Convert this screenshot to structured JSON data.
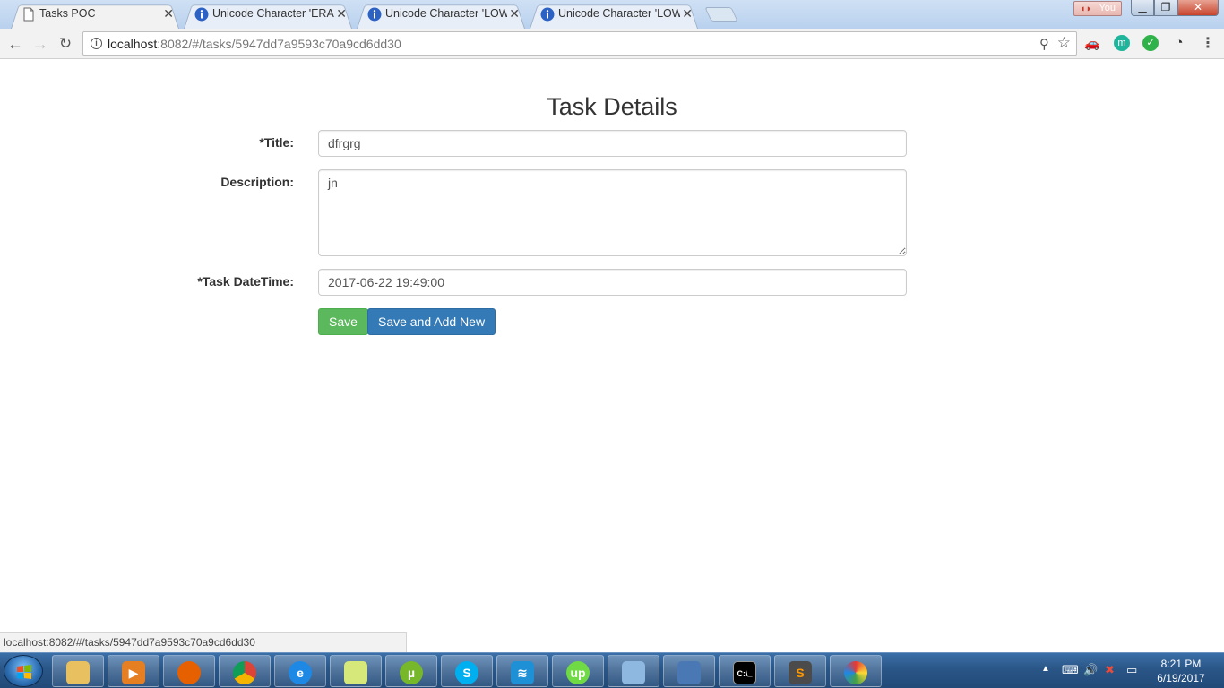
{
  "browser": {
    "tabs": [
      {
        "title": "Tasks POC",
        "icon": "page-icon",
        "active": true
      },
      {
        "title": "Unicode Character 'ERAS",
        "icon": "info-circle-icon",
        "active": false
      },
      {
        "title": "Unicode Character 'LOW",
        "icon": "info-circle-icon",
        "active": false
      },
      {
        "title": "Unicode Character 'LOW",
        "icon": "info-circle-icon",
        "active": false
      }
    ],
    "profile_label": "You",
    "url_host": "localhost",
    "url_rest": ":8082/#/tasks/5947dd7a9593c70a9cd6dd30",
    "extension_badge_m": "m",
    "status_url": "localhost:8082/#/tasks/5947dd7a9593c70a9cd6dd30"
  },
  "page": {
    "title": "Task Details",
    "fields": {
      "title_label": "*Title:",
      "title_value": "dfrgrg",
      "description_label": "Description:",
      "description_value": "jn",
      "datetime_label": "*Task DateTime:",
      "datetime_value": "2017-06-22 19:49:00"
    },
    "buttons": {
      "save": "Save",
      "save_and_add_new": "Save and Add New"
    }
  },
  "taskbar": {
    "time": "8:21 PM",
    "date": "6/19/2017"
  },
  "colors": {
    "save_button": "#5cb85c",
    "save_new_button": "#337ab7",
    "taskbar": "#2a5687"
  }
}
